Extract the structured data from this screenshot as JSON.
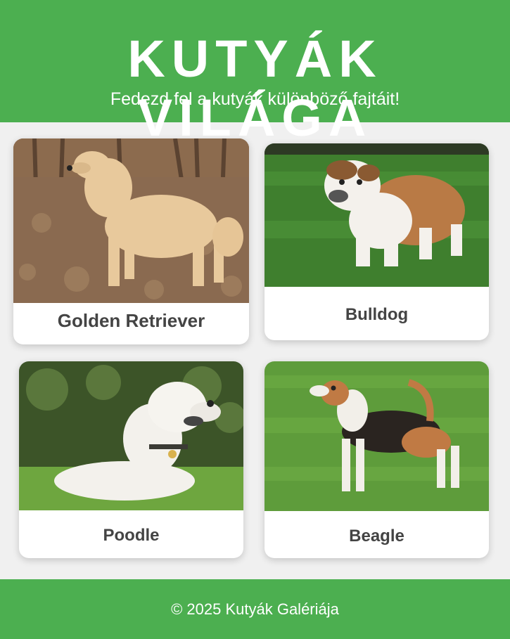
{
  "header": {
    "title": "KUTYÁK VILÁGA",
    "subtitle": "Fedezd fel a kutyák különböző fajtáit!"
  },
  "gallery": {
    "cards": [
      {
        "label": "Golden Retriever",
        "image": "golden-retriever-photo"
      },
      {
        "label": "Bulldog",
        "image": "bulldog-photo"
      },
      {
        "label": "Poodle",
        "image": "poodle-photo"
      },
      {
        "label": "Beagle",
        "image": "beagle-photo"
      }
    ]
  },
  "footer": {
    "text": "© 2025 Kutyák Galériája"
  },
  "colors": {
    "accent": "#4caf50",
    "background": "#f0f0f0",
    "card": "#ffffff",
    "caption_text": "#444444"
  }
}
